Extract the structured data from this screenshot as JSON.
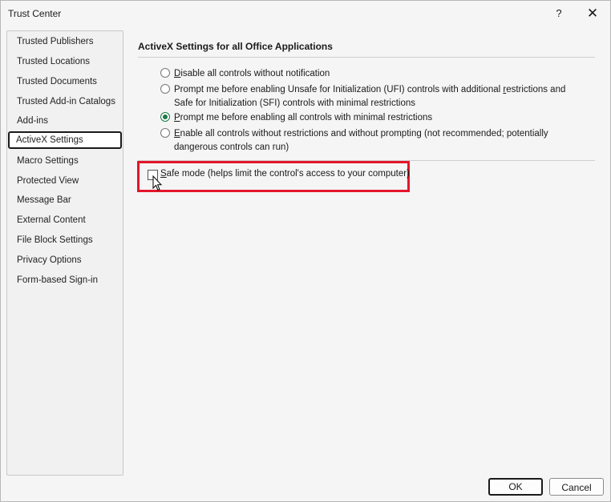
{
  "window": {
    "title": "Trust Center",
    "help_label": "?",
    "close_label": "✕"
  },
  "sidebar": {
    "items": [
      {
        "label": "Trusted Publishers"
      },
      {
        "label": "Trusted Locations"
      },
      {
        "label": "Trusted Documents"
      },
      {
        "label": "Trusted Add-in Catalogs"
      },
      {
        "label": "Add-ins"
      },
      {
        "label": "ActiveX Settings",
        "selected": true
      },
      {
        "label": "Macro Settings"
      },
      {
        "label": "Protected View"
      },
      {
        "label": "Message Bar"
      },
      {
        "label": "External Content"
      },
      {
        "label": "File Block Settings"
      },
      {
        "label": "Privacy Options"
      },
      {
        "label": "Form-based Sign-in"
      }
    ]
  },
  "main": {
    "section_title": "ActiveX Settings for all Office Applications",
    "options": [
      {
        "accel": "D",
        "rest": "isable all controls without notification",
        "checked": false
      },
      {
        "accel": "",
        "pre": "Prompt me before enabling Unsafe for Initialization (UFI) controls with additional ",
        "accel_mid": "r",
        "rest": "estrictions and Safe for Initialization (SFI) controls with minimal restrictions",
        "checked": false
      },
      {
        "accel": "P",
        "rest": "rompt me before enabling all controls with minimal restrictions",
        "checked": true
      },
      {
        "accel": "E",
        "rest": "nable all controls without restrictions and without prompting (not recommended; potentially dangerous controls can run)",
        "checked": false
      }
    ],
    "safe_mode": {
      "accel": "S",
      "rest": "afe mode (helps limit the control's access to your computer)",
      "checked": false
    }
  },
  "buttons": {
    "ok": "OK",
    "cancel": "Cancel"
  },
  "colors": {
    "highlight": "#e3162b",
    "radio_selected": "#1b7a48"
  }
}
